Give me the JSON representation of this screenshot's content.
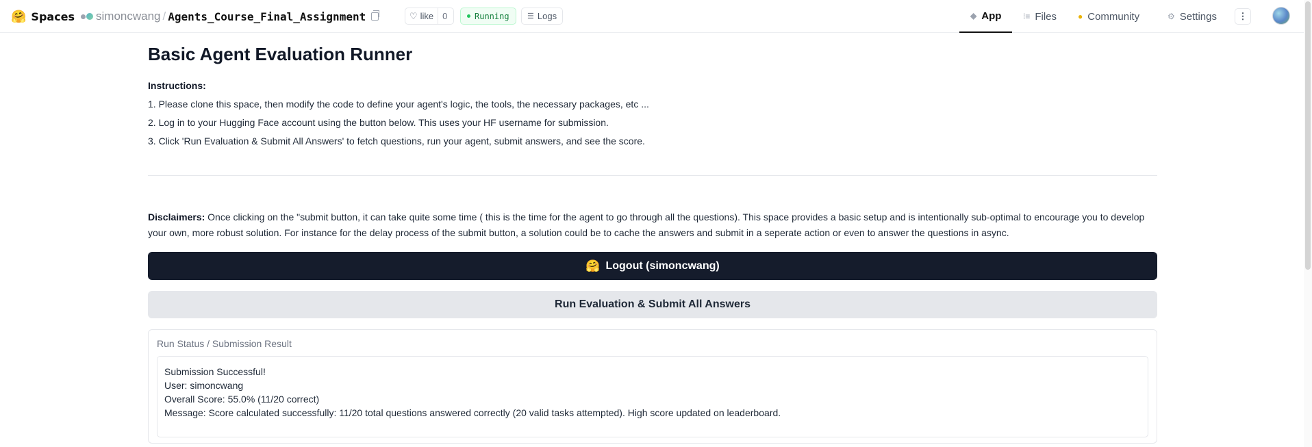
{
  "topbar": {
    "brand": "Spaces",
    "owner": "simoncwang",
    "separator": "/",
    "repo": "Agents_Course_Final_Assignment",
    "like_label": "like",
    "like_count": "0",
    "status": "Running",
    "logs_label": "Logs",
    "tabs": [
      {
        "label": "App",
        "icon": "cube-icon"
      },
      {
        "label": "Files",
        "icon": "files-icon"
      },
      {
        "label": "Community",
        "icon": "community-icon"
      },
      {
        "label": "Settings",
        "icon": "gear-icon"
      }
    ],
    "active_tab": "App",
    "colors": {
      "running_text": "#15803d",
      "running_bg": "#f0fdf4"
    }
  },
  "main": {
    "title": "Basic Agent Evaluation Runner",
    "instructions_heading": "Instructions:",
    "instructions": [
      "1. Please clone this space, then modify the code to define your agent's logic, the tools, the necessary packages, etc ...",
      "2. Log in to your Hugging Face account using the button below. This uses your HF username for submission.",
      "3. Click 'Run Evaluation & Submit All Answers' to fetch questions, run your agent, submit answers, and see the score."
    ],
    "disclaimer_label": "Disclaimers:",
    "disclaimer_text": " Once clicking on the \"submit button, it can take quite some time ( this is the time for the agent to go through all the questions). This space provides a basic setup and is intentionally sub-optimal to encourage you to develop your own, more robust solution. For instance for the delay process of the submit button, a solution could be to cache the answers and submit in a seperate action or even to answer the questions in async.",
    "logout_icon": "🤗",
    "logout_label": "Logout (simoncwang)",
    "run_label": "Run Evaluation & Submit All Answers",
    "result_label": "Run Status / Submission Result",
    "result_lines": [
      "Submission Successful!",
      "User: simoncwang",
      "Overall Score: 55.0% (11/20 correct)",
      "Message: Score calculated successfully: 11/20 total questions answered correctly (20 valid tasks attempted). High score updated on leaderboard."
    ],
    "colors": {
      "logout_bg": "#151c2c",
      "run_bg": "#e5e7eb"
    }
  }
}
